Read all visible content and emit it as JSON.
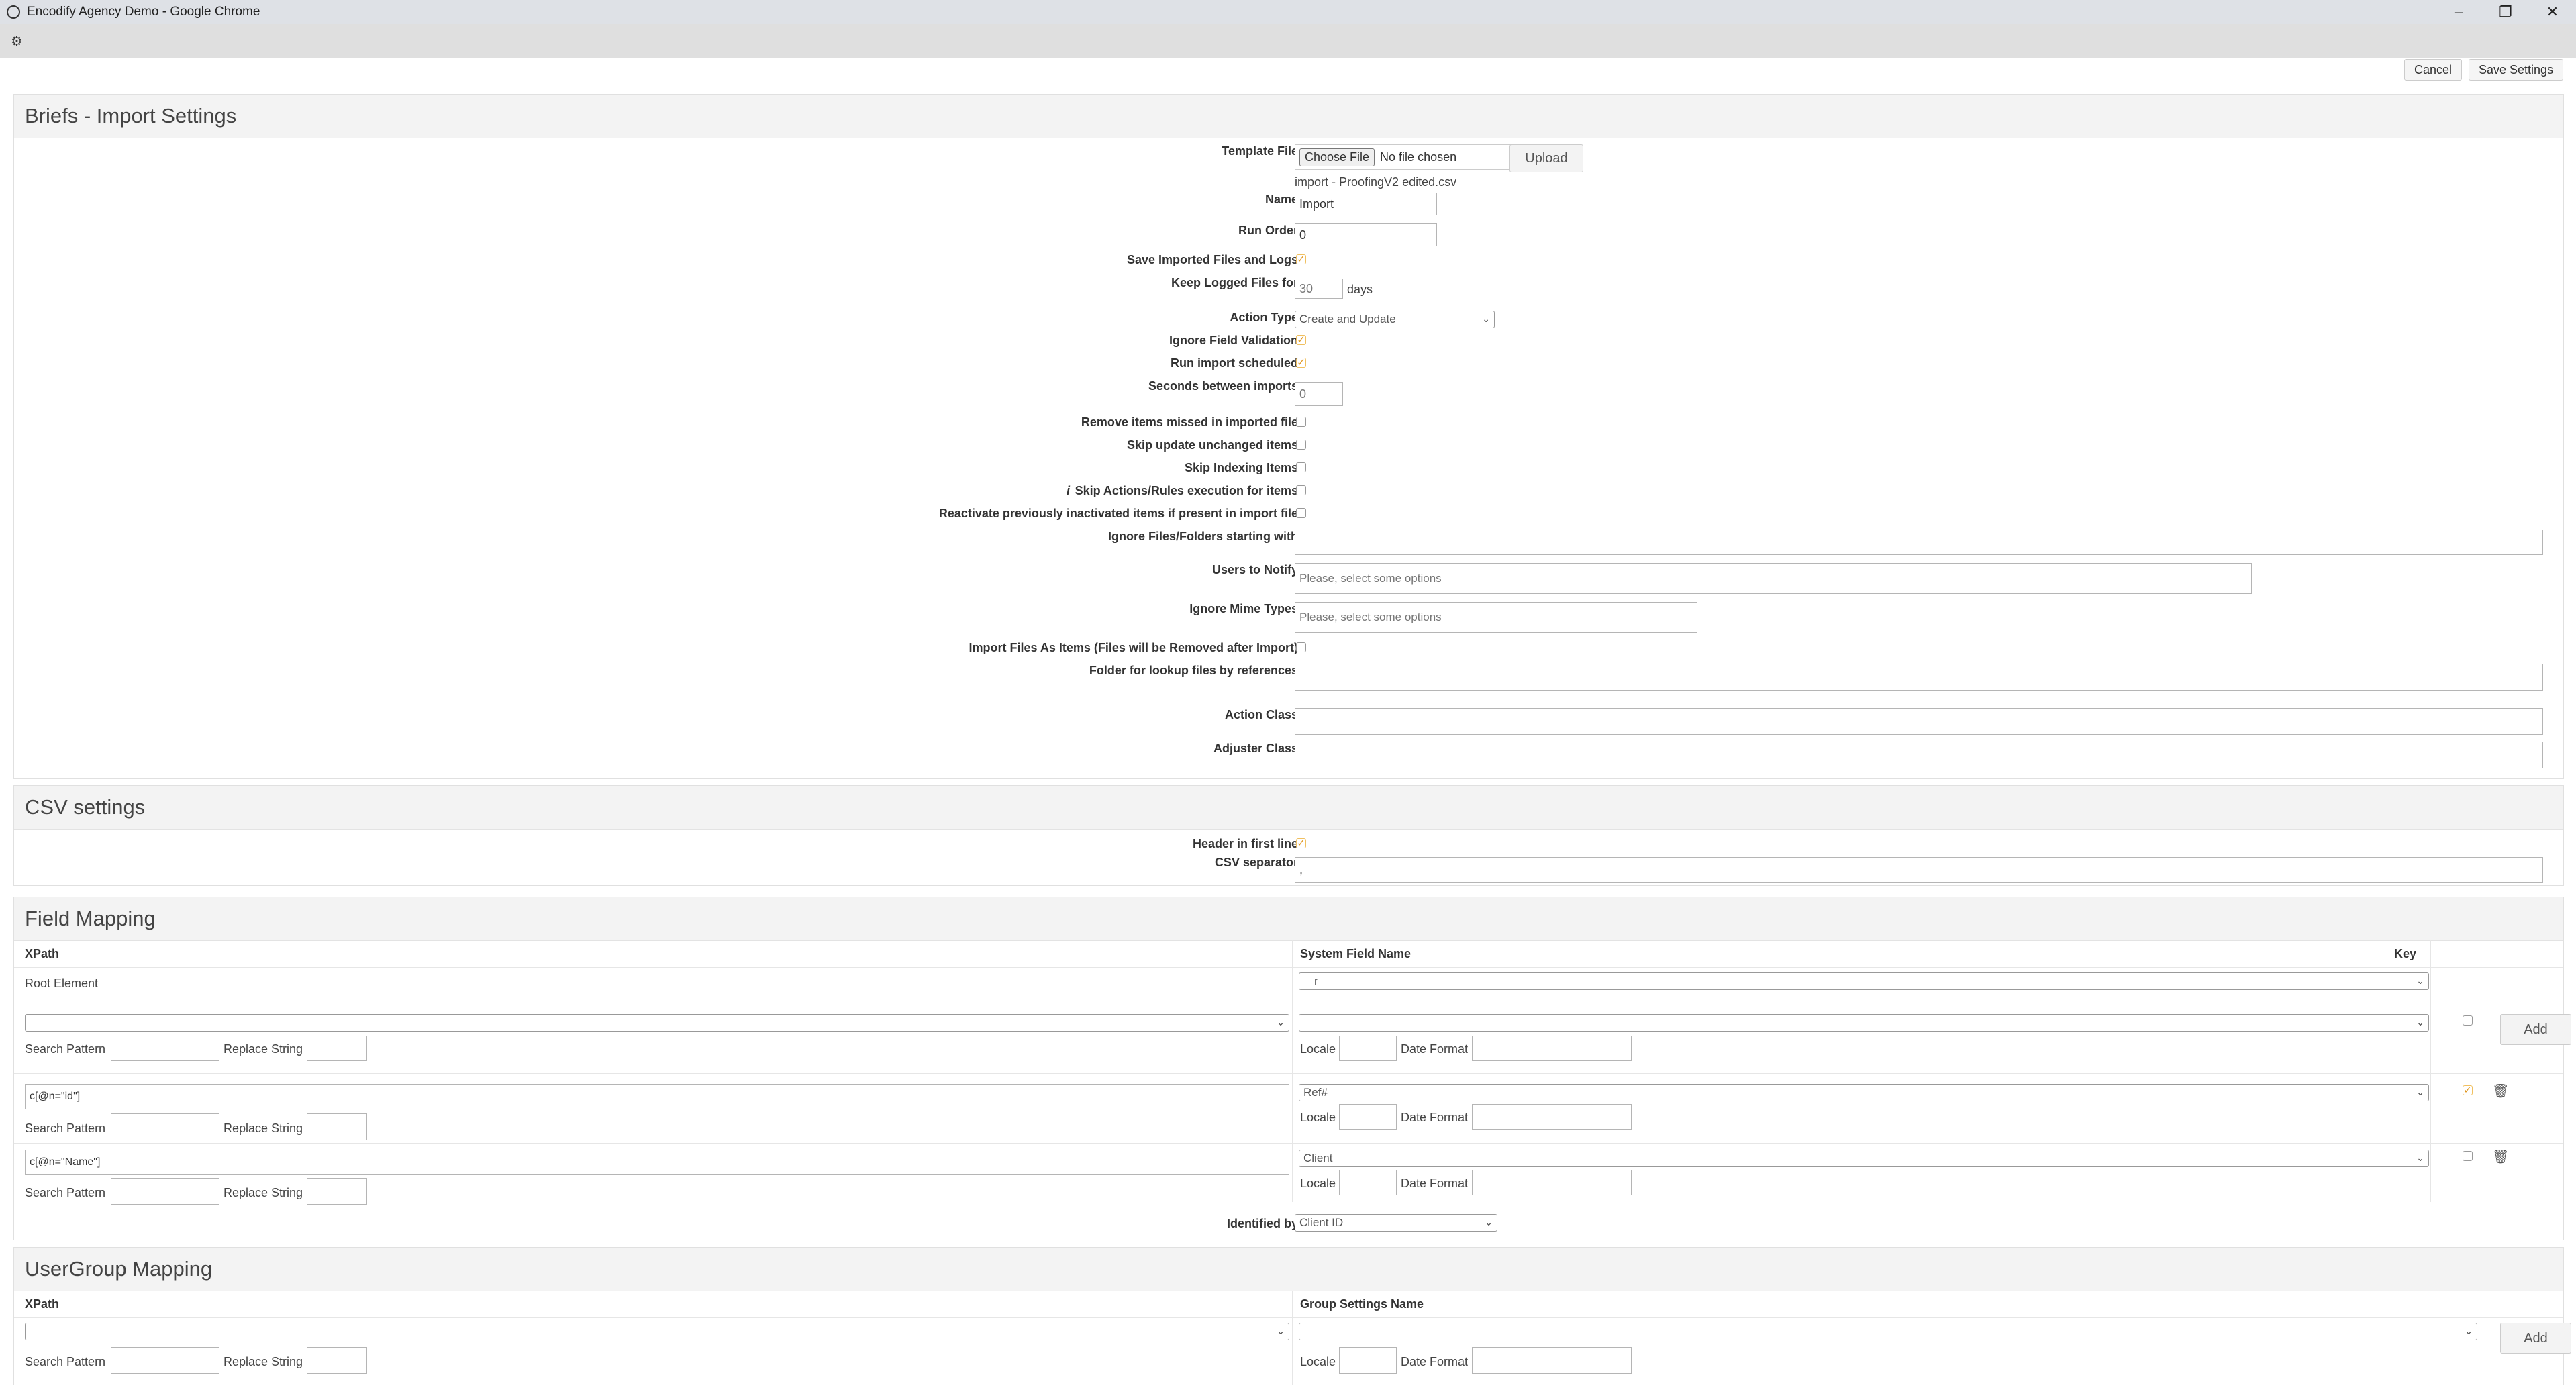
{
  "window": {
    "title": "Encodify Agency Demo - Google Chrome"
  },
  "toolbar": {
    "cancel_label": "Cancel",
    "save_label": "Save Settings"
  },
  "import_settings": {
    "title": "Briefs - Import Settings",
    "template_file_label": "Template File",
    "choose_file_label": "Choose File",
    "no_file_text": "No file chosen",
    "upload_label": "Upload",
    "current_file": "import - ProofingV2 edited.csv",
    "name_label": "Name",
    "name_value": "Import",
    "run_order_label": "Run Order",
    "run_order_value": "0",
    "save_imported_label": "Save Imported Files and Logs",
    "keep_logged_label": "Keep Logged Files for",
    "keep_logged_value": "30",
    "days_label": "days",
    "action_type_label": "Action Type",
    "action_type_value": "Create and Update",
    "ignore_validation_label": "Ignore Field Validation",
    "run_scheduled_label": "Run import scheduled",
    "seconds_label": "Seconds between imports",
    "seconds_value": "0",
    "remove_missed_label": "Remove items missed in imported file",
    "skip_unchanged_label": "Skip update unchanged items",
    "skip_indexing_label": "Skip Indexing Items",
    "skip_actions_label": "Skip Actions/Rules execution for items",
    "info_icon": "i",
    "reactivate_label": "Reactivate previously inactivated items if present in import file",
    "ignore_files_label": "Ignore Files/Folders starting with",
    "users_notify_label": "Users to Notify",
    "users_notify_placeholder": "Please, select some options",
    "ignore_mime_label": "Ignore Mime Types",
    "ignore_mime_placeholder": "Please, select some options",
    "import_files_label": "Import Files As Items (Files will be Removed after Import)",
    "folder_lookup_label": "Folder for lookup files by references",
    "action_class_label": "Action Class",
    "adjuster_class_label": "Adjuster Class"
  },
  "csv_settings": {
    "title": "CSV settings",
    "header_label": "Header in first line",
    "separator_label": "CSV separator",
    "separator_value": ","
  },
  "field_mapping": {
    "title": "Field Mapping",
    "col_xpath": "XPath",
    "col_system": "System Field Name",
    "col_key": "Key",
    "root_label": "Root Element",
    "root_value": "r",
    "search_pattern": "Search Pattern",
    "replace_string": "Replace String",
    "locale": "Locale",
    "date_format": "Date Format",
    "add_label": "Add",
    "rows": [
      {
        "xpath": "c[@n=\"id\"]",
        "field": "Ref#"
      },
      {
        "xpath": "c[@n=\"Name\"]",
        "field": "Client"
      }
    ],
    "identified_by_label": "Identified by",
    "identified_by_value": "Client ID"
  },
  "usergroup_mapping": {
    "title": "UserGroup Mapping",
    "col_xpath": "XPath",
    "col_group": "Group Settings Name",
    "add_label": "Add"
  }
}
